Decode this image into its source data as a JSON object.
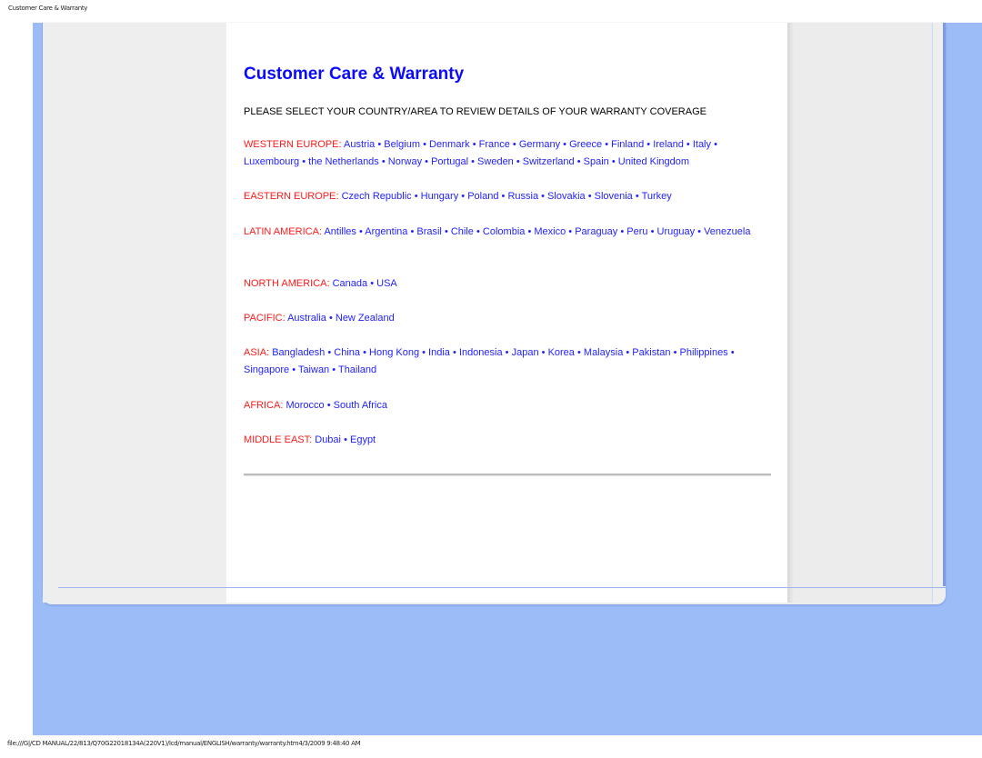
{
  "print_header": "Customer Care & Warranty",
  "print_footer": "file:///G|/CD MANUAL/22/813/Q70G22018134A(220V1)/lcd/manual/ENGLISH/warranty/warranty.htm4/3/2009 9:48:40 AM",
  "page": {
    "title": "Customer Care & Warranty",
    "intro": "PLEASE SELECT YOUR COUNTRY/AREA TO REVIEW DETAILS OF YOUR WARRANTY COVERAGE"
  },
  "colors": {
    "title": "#0a0aff",
    "region_label": "#ff1a1a",
    "link": "#1f1fff",
    "frame_blue": "#9bbcf7"
  },
  "regions": [
    {
      "name": "WESTERN EUROPE:",
      "countries": [
        "Austria",
        "Belgium",
        "Denmark",
        "France",
        "Germany",
        "Greece",
        "Finland",
        "Ireland",
        "Italy",
        "Luxembourg",
        "the Netherlands",
        "Norway",
        "Portugal",
        "Sweden",
        "Switzerland",
        "Spain",
        "United Kingdom"
      ]
    },
    {
      "name": "EASTERN EUROPE:",
      "countries": [
        "Czech Republic",
        "Hungary",
        "Poland",
        "Russia",
        "Slovakia",
        "Slovenia",
        "Turkey"
      ]
    },
    {
      "name": "LATIN AMERICA:",
      "countries": [
        "Antilles",
        "Argentina",
        "Brasil",
        "Chile",
        "Colombia",
        "Mexico",
        "Paraguay",
        "Peru",
        "Uruguay",
        "Venezuela"
      ]
    },
    {
      "name": "NORTH AMERICA:",
      "countries": [
        "Canada",
        "USA"
      ]
    },
    {
      "name": "PACIFIC:",
      "countries": [
        "Australia",
        "New Zealand"
      ]
    },
    {
      "name": "ASIA:",
      "countries": [
        "Bangladesh",
        "China",
        "Hong Kong",
        "India",
        "Indonesia",
        "Japan",
        "Korea",
        "Malaysia",
        "Pakistan",
        "Philippines",
        "Singapore",
        "Taiwan",
        "Thailand"
      ]
    },
    {
      "name": "AFRICA:",
      "countries": [
        "Morocco",
        "South Africa"
      ]
    },
    {
      "name": "MIDDLE EAST:",
      "countries": [
        "Dubai",
        "Egypt"
      ]
    }
  ],
  "separator": "•"
}
